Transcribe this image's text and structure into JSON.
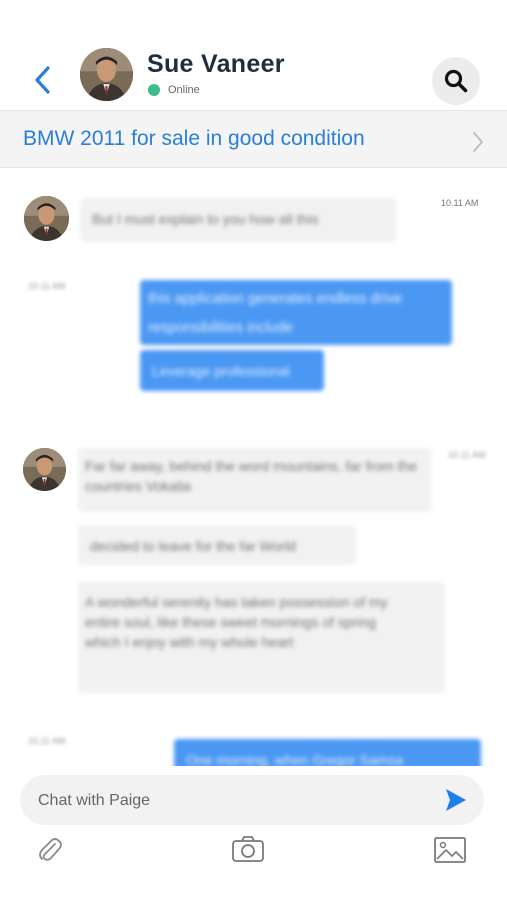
{
  "header": {
    "contact_name": "Sue Vaneer",
    "status_text": "Online",
    "status_color": "#3dbd8a"
  },
  "topic": {
    "title": "BMW 2011 for sale in good condition"
  },
  "messages": [
    {
      "dir": "in",
      "text": "But I must explain to you how all this",
      "time": "10.11 AM"
    },
    {
      "dir": "out",
      "text": "this application generates endless drive responsibilities include",
      "time": "10.11 AM"
    },
    {
      "dir": "out",
      "text": "Leverage professional",
      "time": ""
    },
    {
      "dir": "in",
      "text": "Far far away, behind the word mountains, far from the countries Vokalia",
      "time": "10.11 AM"
    },
    {
      "dir": "in",
      "text": "decided to leave for the far World",
      "time": ""
    },
    {
      "dir": "in",
      "text": "A wonderful serenity has taken possession of my entire soul, like these sweet mornings of spring which I enjoy with my whole heart",
      "time": ""
    },
    {
      "dir": "out",
      "text": "One morning, when Gregor Samsa",
      "time": "10.11 AM"
    }
  ],
  "composer": {
    "placeholder": "Chat with Paige"
  },
  "icons": {
    "back": "chevron-left-icon",
    "search": "search-icon",
    "topic_chevron": "chevron-right-icon",
    "send": "send-icon",
    "attach": "paperclip-icon",
    "camera": "camera-icon",
    "gallery": "image-icon"
  },
  "colors": {
    "accent": "#2b7fd6",
    "outgoing_bubble": "#4b98f3",
    "incoming_bubble": "#f1f1f1"
  }
}
